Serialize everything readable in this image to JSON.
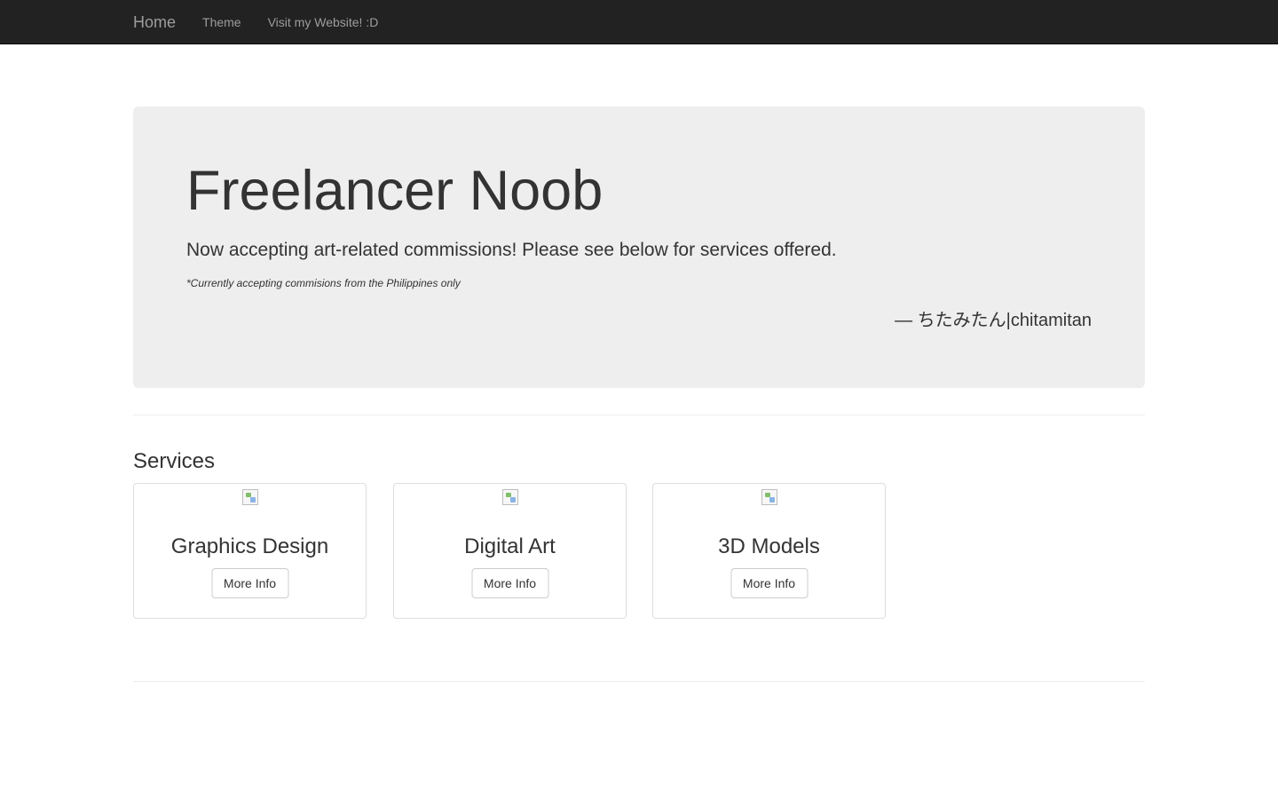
{
  "navbar": {
    "brand": "Home",
    "links": [
      "Theme",
      "Visit my Website! :D"
    ]
  },
  "jumbotron": {
    "title": "Freelancer Noob",
    "lead": "Now accepting art-related commissions! Please see below for services offered.",
    "note": "*Currently accepting commisions from the Philippines only",
    "quote": "— ちたみたん|chitamitan"
  },
  "services": {
    "title": "Services",
    "cards": [
      {
        "title": "Graphics Design",
        "button": "More Info"
      },
      {
        "title": "Digital Art",
        "button": "More Info"
      },
      {
        "title": "3D Models",
        "button": "More Info"
      }
    ]
  },
  "colors": {
    "navbar_bg": "#222222",
    "nav_text": "#9d9d9d",
    "jumbotron_bg": "#eeeeee",
    "text": "#333333"
  }
}
